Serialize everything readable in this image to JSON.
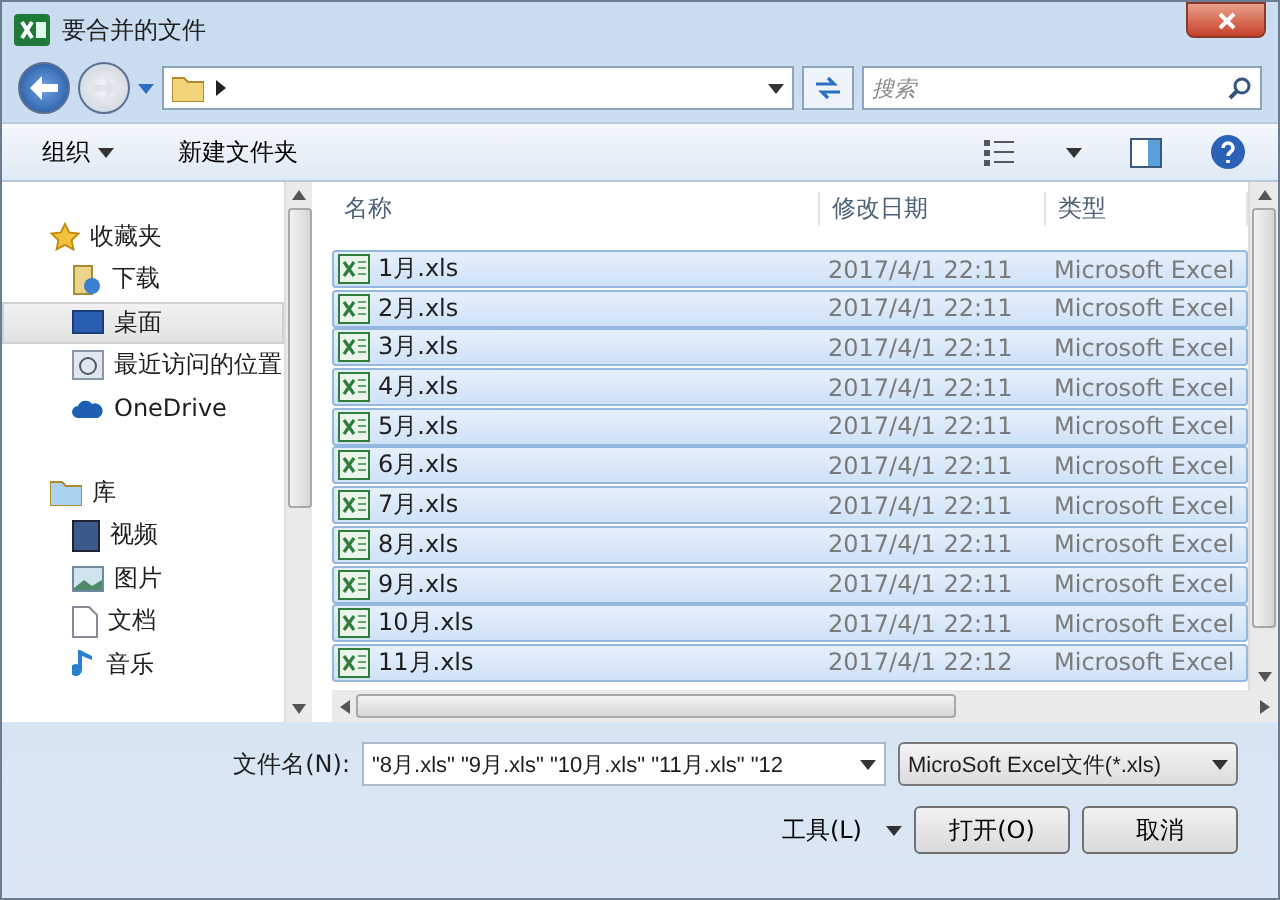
{
  "window": {
    "title": "要合并的文件"
  },
  "address": {
    "search_placeholder": "搜索"
  },
  "toolbar": {
    "organize": "组织",
    "new_folder": "新建文件夹"
  },
  "sidebar": {
    "groups": [
      {
        "label": "收藏夹",
        "kind": "star",
        "children": [
          {
            "label": "下载",
            "kind": "download",
            "selected": false
          },
          {
            "label": "桌面",
            "kind": "desktop",
            "selected": true
          },
          {
            "label": "最近访问的位置",
            "kind": "recent",
            "selected": false
          },
          {
            "label": "OneDrive",
            "kind": "cloud",
            "selected": false
          }
        ]
      },
      {
        "label": "库",
        "kind": "library",
        "children": [
          {
            "label": "视频",
            "kind": "video",
            "selected": false
          },
          {
            "label": "图片",
            "kind": "picture",
            "selected": false
          },
          {
            "label": "文档",
            "kind": "document",
            "selected": false
          },
          {
            "label": "音乐",
            "kind": "music",
            "selected": false
          }
        ]
      }
    ]
  },
  "table": {
    "columns": [
      "名称",
      "修改日期",
      "类型"
    ],
    "rows": [
      {
        "name": "1月.xls",
        "date": "2017/4/1 22:11",
        "type": "Microsoft Excel",
        "selected": true
      },
      {
        "name": "2月.xls",
        "date": "2017/4/1 22:11",
        "type": "Microsoft Excel",
        "selected": true
      },
      {
        "name": "3月.xls",
        "date": "2017/4/1 22:11",
        "type": "Microsoft Excel",
        "selected": true
      },
      {
        "name": "4月.xls",
        "date": "2017/4/1 22:11",
        "type": "Microsoft Excel",
        "selected": true
      },
      {
        "name": "5月.xls",
        "date": "2017/4/1 22:11",
        "type": "Microsoft Excel",
        "selected": true
      },
      {
        "name": "6月.xls",
        "date": "2017/4/1 22:11",
        "type": "Microsoft Excel",
        "selected": true
      },
      {
        "name": "7月.xls",
        "date": "2017/4/1 22:11",
        "type": "Microsoft Excel",
        "selected": true
      },
      {
        "name": "8月.xls",
        "date": "2017/4/1 22:11",
        "type": "Microsoft Excel",
        "selected": true
      },
      {
        "name": "9月.xls",
        "date": "2017/4/1 22:11",
        "type": "Microsoft Excel",
        "selected": true
      },
      {
        "name": "10月.xls",
        "date": "2017/4/1 22:11",
        "type": "Microsoft Excel",
        "selected": true
      },
      {
        "name": "11月.xls",
        "date": "2017/4/1 22:12",
        "type": "Microsoft Excel",
        "selected": true
      }
    ]
  },
  "footer": {
    "filename_label": "文件名(N):",
    "filename_value": "\"8月.xls\" \"9月.xls\" \"10月.xls\" \"11月.xls\" \"12",
    "filter": "MicroSoft Excel文件(*.xls)",
    "tools": "工具(L)",
    "open": "打开(O)",
    "cancel": "取消"
  }
}
